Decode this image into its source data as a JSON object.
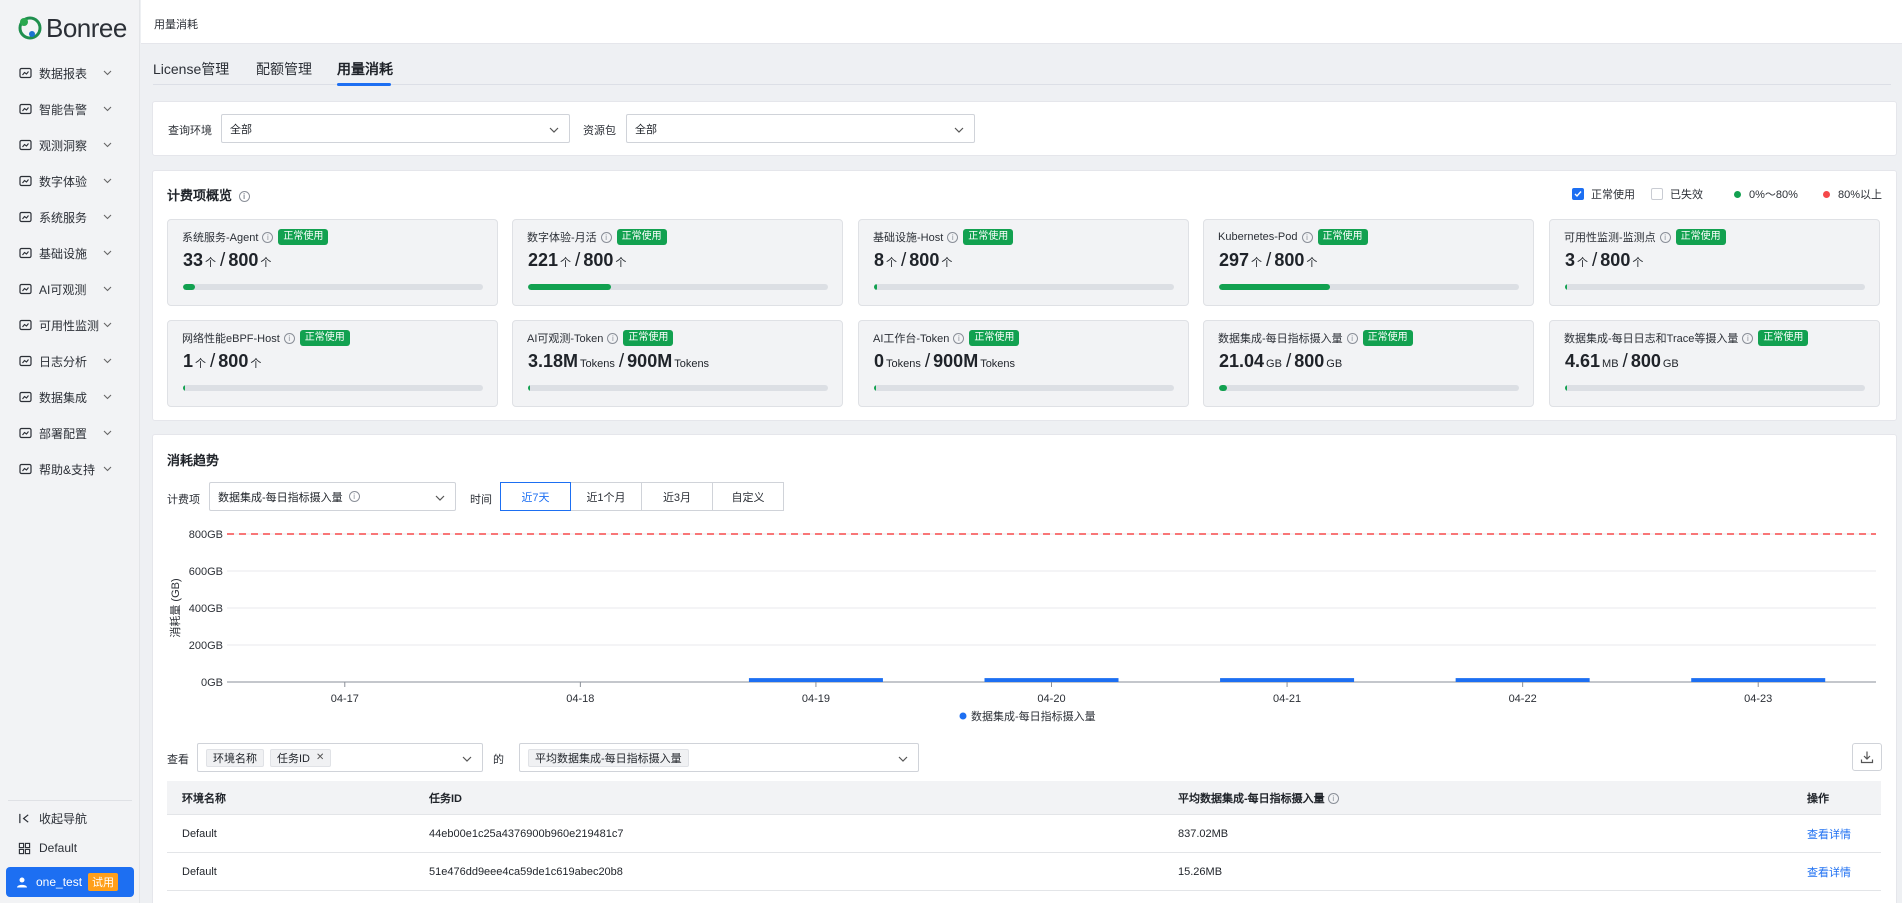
{
  "brand": {
    "name": "Bonree"
  },
  "sidebar": {
    "items": [
      {
        "label": "数据报表",
        "icon": "report-chart-icon"
      },
      {
        "label": "智能告警",
        "icon": "alarm-bell-icon"
      },
      {
        "label": "观测洞察",
        "icon": "insight-search-icon"
      },
      {
        "label": "数字体验",
        "icon": "digital-experience-icon"
      },
      {
        "label": "系统服务",
        "icon": "system-service-icon"
      },
      {
        "label": "基础设施",
        "icon": "infrastructure-icon"
      },
      {
        "label": "AI可观测",
        "icon": "ai-icon"
      },
      {
        "label": "可用性监测",
        "icon": "availability-monitor-icon"
      },
      {
        "label": "日志分析",
        "icon": "log-analysis-icon"
      },
      {
        "label": "数据集成",
        "icon": "data-integration-icon"
      },
      {
        "label": "部署配置",
        "icon": "wrench-icon"
      },
      {
        "label": "帮助&支持",
        "icon": "help-book-icon"
      }
    ],
    "collapse_label": "收起导航",
    "workspace_label": "Default",
    "user": {
      "name": "one_test",
      "badge": "试用"
    }
  },
  "topbar": {
    "title": "用量消耗"
  },
  "tabs": [
    {
      "label": "License管理",
      "active": false
    },
    {
      "label": "配额管理",
      "active": false
    },
    {
      "label": "用量消耗",
      "active": true
    }
  ],
  "filters": {
    "env_label": "查询环境",
    "env_value": "全部",
    "pkg_label": "资源包",
    "pkg_value": "全部"
  },
  "overview": {
    "title": "计费项概览",
    "legend": {
      "normal_label": "正常使用",
      "expired_label": "已失效",
      "green_label": "0%～80%",
      "red_label": "80%以上"
    },
    "status_colors": {
      "green": "#12a150",
      "red": "#f5484a",
      "accent": "#1d6ff2"
    },
    "cards": [
      {
        "name": "系统服务-Agent",
        "status": "正常使用",
        "used": "33",
        "used_unit": "个",
        "total": "800",
        "total_unit": "个",
        "percent": 4.1
      },
      {
        "name": "数字体验-月活",
        "status": "正常使用",
        "used": "221",
        "used_unit": "个",
        "total": "800",
        "total_unit": "个",
        "percent": 27.6
      },
      {
        "name": "基础设施-Host",
        "status": "正常使用",
        "used": "8",
        "used_unit": "个",
        "total": "800",
        "total_unit": "个",
        "percent": 1.0
      },
      {
        "name": "Kubernetes-Pod",
        "status": "正常使用",
        "used": "297",
        "used_unit": "个",
        "total": "800",
        "total_unit": "个",
        "percent": 37.1
      },
      {
        "name": "可用性监测-监测点",
        "status": "正常使用",
        "used": "3",
        "used_unit": "个",
        "total": "800",
        "total_unit": "个",
        "percent": 0.4
      },
      {
        "name": "网络性能eBPF-Host",
        "status": "正常使用",
        "used": "1",
        "used_unit": "个",
        "total": "800",
        "total_unit": "个",
        "percent": 0.1
      },
      {
        "name": "AI可观测-Token",
        "status": "正常使用",
        "used": "3.18M",
        "used_unit": "Tokens",
        "total": "900M",
        "total_unit": "Tokens",
        "percent": 0.35
      },
      {
        "name": "AI工作台-Token",
        "status": "正常使用",
        "used": "0",
        "used_unit": "Tokens",
        "total": "900M",
        "total_unit": "Tokens",
        "percent": 0
      },
      {
        "name": "数据集成-每日指标摄入量",
        "status": "正常使用",
        "used": "21.04",
        "used_unit": "GB",
        "total": "800",
        "total_unit": "GB",
        "percent": 2.6
      },
      {
        "name": "数据集成-每日日志和Trace等摄入量",
        "status": "正常使用",
        "used": "4.61",
        "used_unit": "MB",
        "total": "800",
        "total_unit": "GB",
        "percent": 0.01
      }
    ]
  },
  "trend": {
    "title": "消耗趋势",
    "item_label": "计费项",
    "item_value": "数据集成-每日指标摄入量",
    "time_label": "时间",
    "time_options": [
      {
        "label": "近7天",
        "active": true
      },
      {
        "label": "近1个月",
        "active": false
      },
      {
        "label": "近3月",
        "active": false
      },
      {
        "label": "自定义",
        "active": false
      }
    ]
  },
  "chart_data": {
    "type": "bar",
    "ylabel": "消耗量 (GB)",
    "categories": [
      "04-17",
      "04-18",
      "04-19",
      "04-20",
      "04-21",
      "04-22",
      "04-23"
    ],
    "yticks": [
      "0GB",
      "200GB",
      "400GB",
      "600GB",
      "800GB"
    ],
    "ylim": [
      0,
      800
    ],
    "threshold": {
      "value": 800,
      "label": "800GB",
      "color": "#f5484a",
      "style": "dashed"
    },
    "series": [
      {
        "name": "数据集成-每日指标摄入量",
        "color": "#1d6ff2",
        "values": [
          0,
          0,
          21.04,
          21.04,
          21.04,
          21.04,
          21.04
        ]
      }
    ],
    "grid": true,
    "legend": "bottom-center"
  },
  "detail": {
    "view_label": "查看",
    "dims": [
      "环境名称",
      "任务ID"
    ],
    "of_label": "的",
    "metric_tag": "平均数据集成-每日指标摄入量",
    "columns": [
      "环境名称",
      "任务ID",
      "平均数据集成-每日指标摄入量",
      "操作"
    ],
    "rows": [
      {
        "env": "Default",
        "task_id": "44eb00e1c25a4376900b960e219481c7",
        "value": "837.02MB",
        "action": "查看详情"
      },
      {
        "env": "Default",
        "task_id": "51e476dd9eee4ca59de1c619abec20b8",
        "value": "15.26MB",
        "action": "查看详情"
      }
    ]
  }
}
